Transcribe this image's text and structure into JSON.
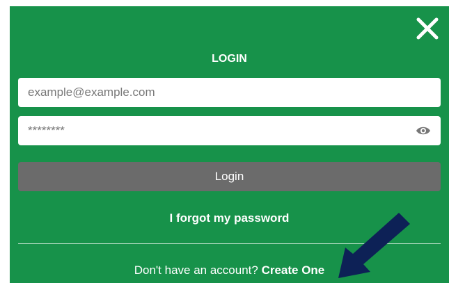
{
  "modal": {
    "title": "LOGIN",
    "close_icon": "close-icon",
    "email": {
      "value": "",
      "placeholder": "example@example.com"
    },
    "password": {
      "value": "********",
      "placeholder": "",
      "toggle_icon": "eye-icon"
    },
    "login_label": "Login",
    "forgot_label": "I forgot my password",
    "signup_prompt": "Don't have an account?",
    "signup_link": "Create One"
  },
  "annotation": {
    "icon": "arrow-icon",
    "color": "#0d2156"
  },
  "colors": {
    "background": "#17924a",
    "button": "#6b6b6b",
    "text": "#ffffff"
  }
}
